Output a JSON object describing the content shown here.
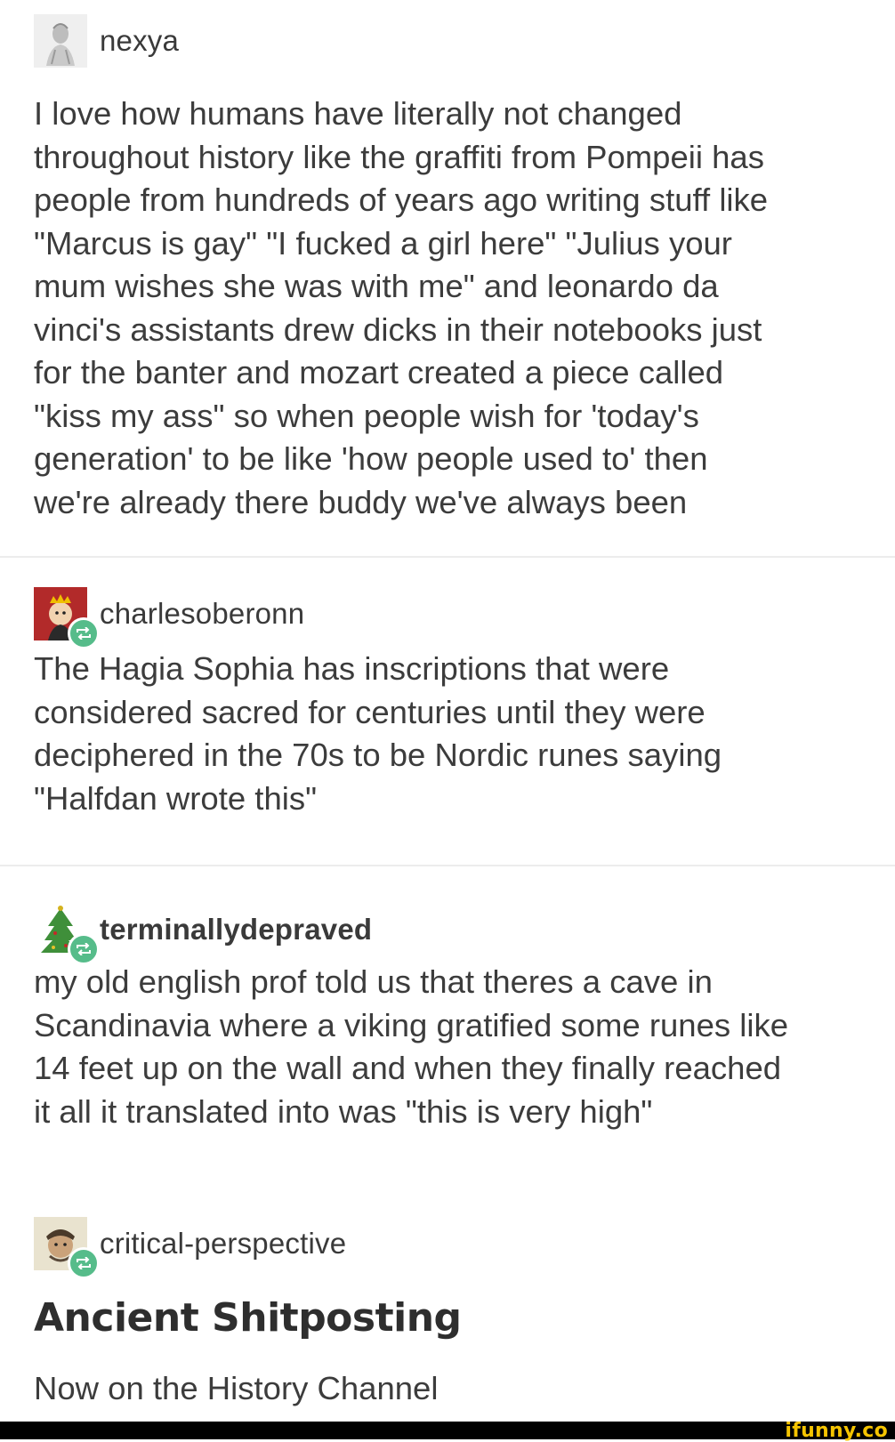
{
  "posts": [
    {
      "username": "nexya",
      "text": "I love how humans have literally not changed\nthroughout history like the graffiti from Pompeii has\npeople from hundreds of years ago writing stuff like\n\"Marcus is gay\" \"I fucked a girl here\" \"Julius your\nmum wishes she was with me\" and leonardo da\nvinci's assistants drew dicks in their notebooks just\nfor the banter and mozart created a piece called\n\"kiss my ass\" so when people wish for 'today's\ngeneration' to be like 'how people used to' then\nwe're already there buddy we've always been"
    },
    {
      "username": "charlesoberonn",
      "text": "The Hagia Sophia has inscriptions that were\nconsidered sacred for centuries until they were\ndeciphered in the 70s to be Nordic runes saying\n\"Halfdan wrote this\""
    },
    {
      "username": "terminallydepraved",
      "text": "my old english prof told us that theres a cave in\nScandinavia where a viking gratified some runes like\n14 feet up on the wall and when they finally reached\nit all it translated into was \"this is very high\""
    },
    {
      "username": "critical-perspective",
      "title": "Ancient Shitposting",
      "text": "Now on the History Channel"
    }
  ],
  "watermark": "ifunny.co",
  "colors": {
    "reblog_badge": "#56bc8a",
    "watermark": "#f5c400",
    "divider": "#ececec"
  }
}
